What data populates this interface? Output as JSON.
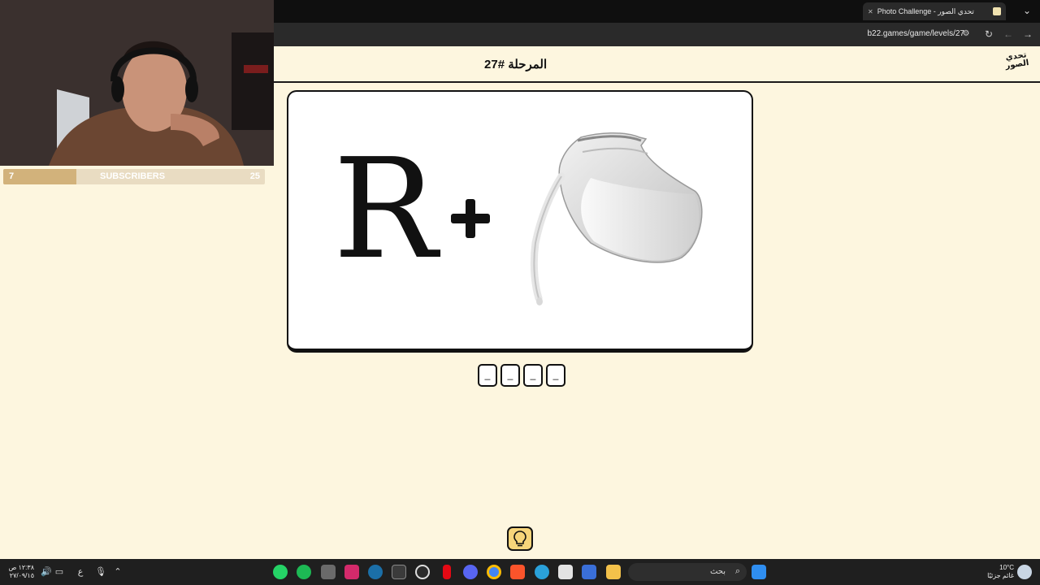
{
  "browser": {
    "tab_title": "Photo Challenge - تحدي الصور",
    "url": "b22.games/game/levels/27",
    "new_tab_label": "+",
    "close_tab_label": "✕",
    "menu_label": "⌄",
    "reload_label": "↻",
    "back_label": "←",
    "forward_label": "→"
  },
  "game": {
    "level_title": "المرحلة #27",
    "logo_line1": "تحدي",
    "logo_line2": "الصور",
    "puzzle_letter": "R",
    "answer_slots": [
      "_",
      "_",
      "_",
      "_"
    ],
    "hint_icon": "lightbulb-icon"
  },
  "overlay": {
    "sub_current": "7",
    "sub_label": "SUBSCRIBERS",
    "sub_goal": "25",
    "sub_progress": 0.28
  },
  "taskbar": {
    "search_placeholder": "بحث",
    "time": "١٢:٣٨ ص",
    "date": "٢٧/٠٩/١٥",
    "lang": "ع",
    "weather_temp": "10°C",
    "weather_desc": "غائم جزئيًا"
  },
  "colors": {
    "page_bg": "#fdf6df",
    "accent": "#f7d57a"
  }
}
